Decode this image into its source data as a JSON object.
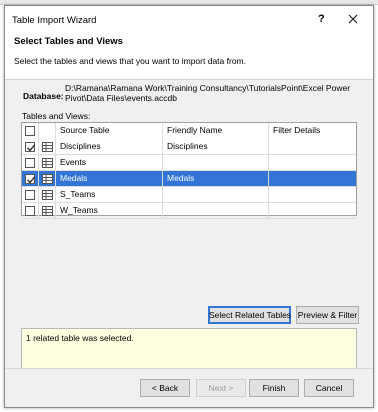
{
  "window": {
    "title": "Table Import Wizard",
    "help_label": "?"
  },
  "header": {
    "title": "Select Tables and Views",
    "description": "Select the tables and views that you want to import data from."
  },
  "database": {
    "label": "Database:",
    "path": "D:\\Ramana\\Ramana Work\\Training  Consultancy\\TutorialsPoint\\Excel Power Pivot\\Data Files\\events.accdb"
  },
  "tables_label": "Tables and Views:",
  "grid": {
    "columns": [
      "Source Table",
      "Friendly Name",
      "Filter Details"
    ],
    "rows": [
      {
        "checked": true,
        "source": "Disciplines",
        "friendly": "Disciplines",
        "filter": "",
        "selected": false
      },
      {
        "checked": false,
        "source": "Events",
        "friendly": "",
        "filter": "",
        "selected": false
      },
      {
        "checked": true,
        "source": "Medals",
        "friendly": "Medals",
        "filter": "",
        "selected": true
      },
      {
        "checked": false,
        "source": "S_Teams",
        "friendly": "",
        "filter": "",
        "selected": false
      },
      {
        "checked": false,
        "source": "W_Teams",
        "friendly": "",
        "filter": "",
        "selected": false
      }
    ]
  },
  "buttons": {
    "select_related": "Select Related Tables",
    "preview_filter": "Preview & Filter",
    "back": "< Back",
    "next": "Next >",
    "finish": "Finish",
    "cancel": "Cancel"
  },
  "status_message": "1 related table was selected.",
  "colors": {
    "selection": "#3375d6",
    "status_bg": "#ffffe1"
  }
}
